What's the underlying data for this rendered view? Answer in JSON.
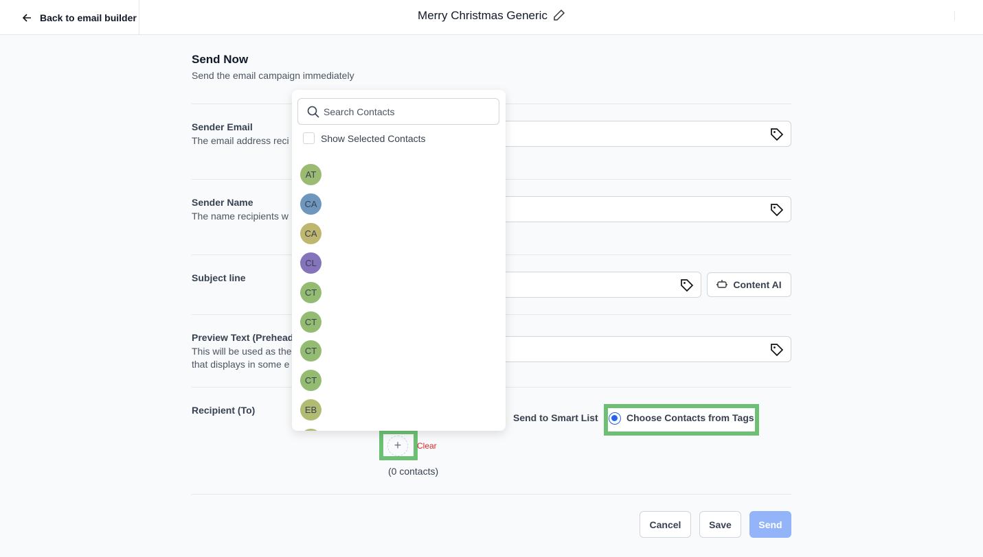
{
  "header": {
    "back_label": "Back to email builder",
    "title": "Merry Christmas Generic"
  },
  "section": {
    "title": "Send Now",
    "subtitle": "Send the email campaign immediately"
  },
  "fields": {
    "sender_email": {
      "label": "Sender Email",
      "desc": "The email address reci"
    },
    "sender_name": {
      "label": "Sender Name",
      "desc": "The name recipients w"
    },
    "subject": {
      "label": "Subject line",
      "content_ai": "Content AI"
    },
    "preview": {
      "label": "Preview Text (Prehead",
      "desc1": "This will be used as the",
      "desc2": "that displays in some e"
    },
    "recipient": {
      "label": "Recipient (To)",
      "option_smart_list": "Send to Smart List",
      "option_tags": "Choose Contacts from Tags",
      "clear": "Clear",
      "count": "(0 contacts)"
    }
  },
  "dropdown": {
    "search_placeholder": "Search Contacts",
    "show_selected": "Show Selected Contacts",
    "contacts": [
      {
        "initials": "AT",
        "color": "#9cbb72"
      },
      {
        "initials": "CA",
        "color": "#6f97bd"
      },
      {
        "initials": "CA",
        "color": "#bfb66f"
      },
      {
        "initials": "CL",
        "color": "#8574bb"
      },
      {
        "initials": "CT",
        "color": "#93bb72"
      },
      {
        "initials": "CT",
        "color": "#93bb72"
      },
      {
        "initials": "CT",
        "color": "#93bb72"
      },
      {
        "initials": "CT",
        "color": "#93bb72"
      },
      {
        "initials": "EB",
        "color": "#b1bc72"
      },
      {
        "initials": "",
        "color": "#b1bc72"
      }
    ]
  },
  "footer": {
    "cancel": "Cancel",
    "save": "Save",
    "send": "Send"
  },
  "colors": {
    "highlight": "#6dbf73",
    "send": "#93b4f8",
    "clear": "#dc2626",
    "radio": "#2563eb"
  }
}
